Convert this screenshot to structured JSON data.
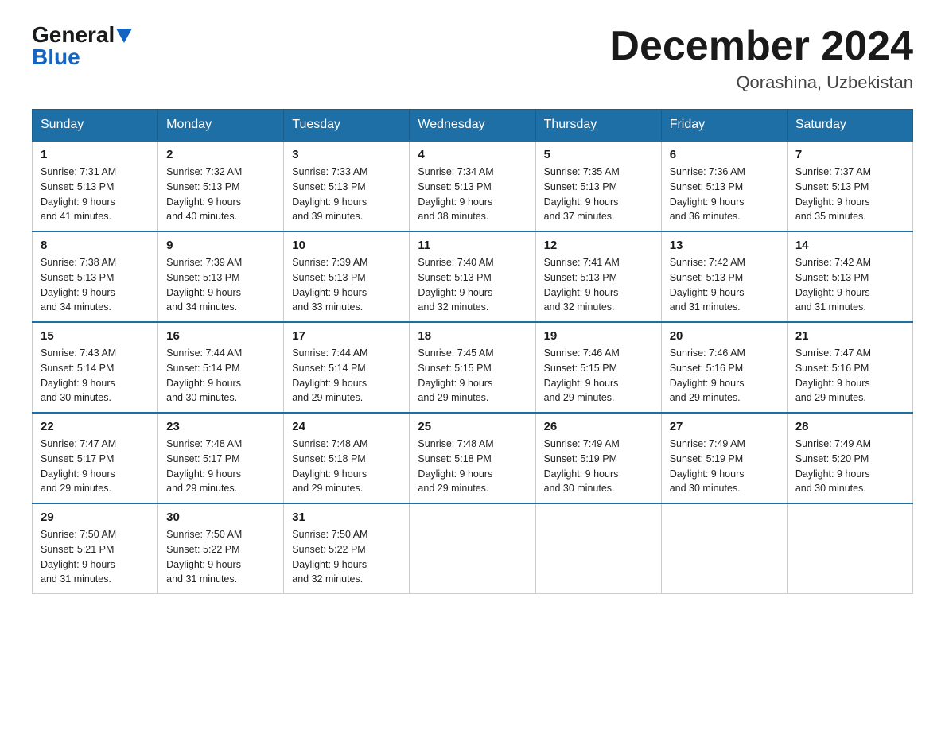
{
  "header": {
    "logo_general": "General",
    "logo_blue": "Blue",
    "month_title": "December 2024",
    "location": "Qorashina, Uzbekistan"
  },
  "days_of_week": [
    "Sunday",
    "Monday",
    "Tuesday",
    "Wednesday",
    "Thursday",
    "Friday",
    "Saturday"
  ],
  "weeks": [
    [
      {
        "day": "1",
        "sunrise": "7:31 AM",
        "sunset": "5:13 PM",
        "daylight": "9 hours and 41 minutes."
      },
      {
        "day": "2",
        "sunrise": "7:32 AM",
        "sunset": "5:13 PM",
        "daylight": "9 hours and 40 minutes."
      },
      {
        "day": "3",
        "sunrise": "7:33 AM",
        "sunset": "5:13 PM",
        "daylight": "9 hours and 39 minutes."
      },
      {
        "day": "4",
        "sunrise": "7:34 AM",
        "sunset": "5:13 PM",
        "daylight": "9 hours and 38 minutes."
      },
      {
        "day": "5",
        "sunrise": "7:35 AM",
        "sunset": "5:13 PM",
        "daylight": "9 hours and 37 minutes."
      },
      {
        "day": "6",
        "sunrise": "7:36 AM",
        "sunset": "5:13 PM",
        "daylight": "9 hours and 36 minutes."
      },
      {
        "day": "7",
        "sunrise": "7:37 AM",
        "sunset": "5:13 PM",
        "daylight": "9 hours and 35 minutes."
      }
    ],
    [
      {
        "day": "8",
        "sunrise": "7:38 AM",
        "sunset": "5:13 PM",
        "daylight": "9 hours and 34 minutes."
      },
      {
        "day": "9",
        "sunrise": "7:39 AM",
        "sunset": "5:13 PM",
        "daylight": "9 hours and 34 minutes."
      },
      {
        "day": "10",
        "sunrise": "7:39 AM",
        "sunset": "5:13 PM",
        "daylight": "9 hours and 33 minutes."
      },
      {
        "day": "11",
        "sunrise": "7:40 AM",
        "sunset": "5:13 PM",
        "daylight": "9 hours and 32 minutes."
      },
      {
        "day": "12",
        "sunrise": "7:41 AM",
        "sunset": "5:13 PM",
        "daylight": "9 hours and 32 minutes."
      },
      {
        "day": "13",
        "sunrise": "7:42 AM",
        "sunset": "5:13 PM",
        "daylight": "9 hours and 31 minutes."
      },
      {
        "day": "14",
        "sunrise": "7:42 AM",
        "sunset": "5:13 PM",
        "daylight": "9 hours and 31 minutes."
      }
    ],
    [
      {
        "day": "15",
        "sunrise": "7:43 AM",
        "sunset": "5:14 PM",
        "daylight": "9 hours and 30 minutes."
      },
      {
        "day": "16",
        "sunrise": "7:44 AM",
        "sunset": "5:14 PM",
        "daylight": "9 hours and 30 minutes."
      },
      {
        "day": "17",
        "sunrise": "7:44 AM",
        "sunset": "5:14 PM",
        "daylight": "9 hours and 29 minutes."
      },
      {
        "day": "18",
        "sunrise": "7:45 AM",
        "sunset": "5:15 PM",
        "daylight": "9 hours and 29 minutes."
      },
      {
        "day": "19",
        "sunrise": "7:46 AM",
        "sunset": "5:15 PM",
        "daylight": "9 hours and 29 minutes."
      },
      {
        "day": "20",
        "sunrise": "7:46 AM",
        "sunset": "5:16 PM",
        "daylight": "9 hours and 29 minutes."
      },
      {
        "day": "21",
        "sunrise": "7:47 AM",
        "sunset": "5:16 PM",
        "daylight": "9 hours and 29 minutes."
      }
    ],
    [
      {
        "day": "22",
        "sunrise": "7:47 AM",
        "sunset": "5:17 PM",
        "daylight": "9 hours and 29 minutes."
      },
      {
        "day": "23",
        "sunrise": "7:48 AM",
        "sunset": "5:17 PM",
        "daylight": "9 hours and 29 minutes."
      },
      {
        "day": "24",
        "sunrise": "7:48 AM",
        "sunset": "5:18 PM",
        "daylight": "9 hours and 29 minutes."
      },
      {
        "day": "25",
        "sunrise": "7:48 AM",
        "sunset": "5:18 PM",
        "daylight": "9 hours and 29 minutes."
      },
      {
        "day": "26",
        "sunrise": "7:49 AM",
        "sunset": "5:19 PM",
        "daylight": "9 hours and 30 minutes."
      },
      {
        "day": "27",
        "sunrise": "7:49 AM",
        "sunset": "5:19 PM",
        "daylight": "9 hours and 30 minutes."
      },
      {
        "day": "28",
        "sunrise": "7:49 AM",
        "sunset": "5:20 PM",
        "daylight": "9 hours and 30 minutes."
      }
    ],
    [
      {
        "day": "29",
        "sunrise": "7:50 AM",
        "sunset": "5:21 PM",
        "daylight": "9 hours and 31 minutes."
      },
      {
        "day": "30",
        "sunrise": "7:50 AM",
        "sunset": "5:22 PM",
        "daylight": "9 hours and 31 minutes."
      },
      {
        "day": "31",
        "sunrise": "7:50 AM",
        "sunset": "5:22 PM",
        "daylight": "9 hours and 32 minutes."
      },
      null,
      null,
      null,
      null
    ]
  ],
  "labels": {
    "sunrise": "Sunrise:",
    "sunset": "Sunset:",
    "daylight": "Daylight:"
  }
}
